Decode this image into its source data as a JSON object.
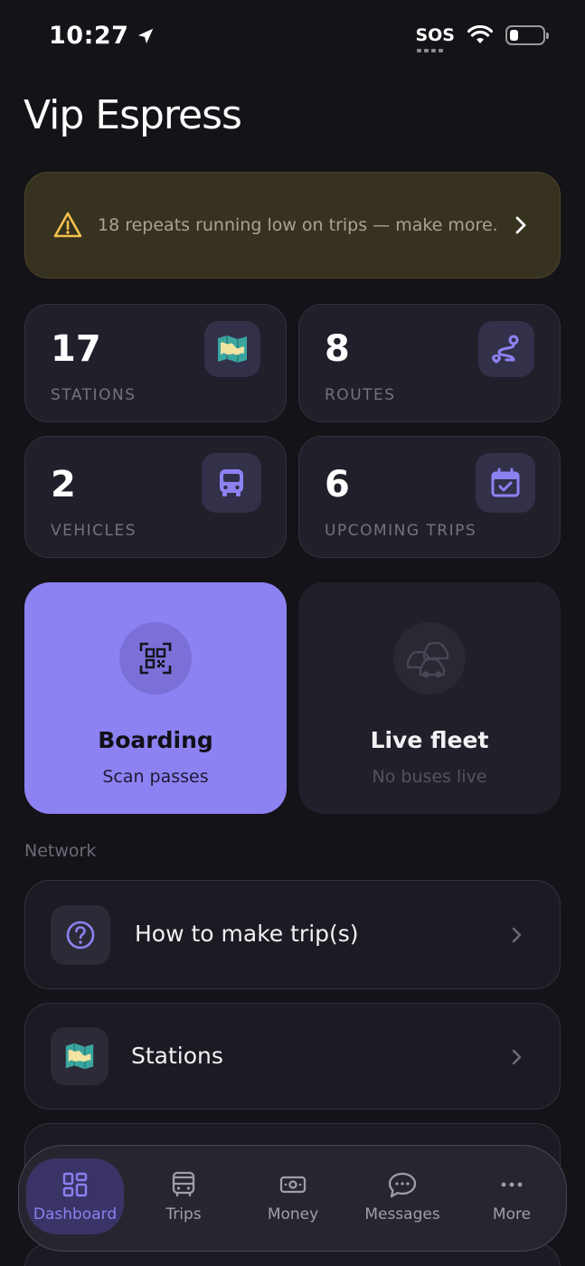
{
  "status_bar": {
    "time": "10:27",
    "sos": "SOS"
  },
  "app": {
    "title": "Vip Espress"
  },
  "alert": {
    "text": "18 repeats running low on trips — make more.",
    "color": "#f2c14e"
  },
  "stats": [
    {
      "value": "17",
      "label": "STATIONS",
      "icon": "map-icon"
    },
    {
      "value": "8",
      "label": "ROUTES",
      "icon": "route-icon"
    },
    {
      "value": "2",
      "label": "VEHICLES",
      "icon": "bus-icon"
    },
    {
      "value": "6",
      "label": "UPCOMING TRIPS",
      "icon": "calendar-check-icon"
    }
  ],
  "actions": {
    "boarding": {
      "title": "Boarding",
      "subtitle": "Scan passes",
      "icon": "qr-scan-icon",
      "color": "#8c82f2"
    },
    "live_fleet": {
      "title": "Live fleet",
      "subtitle": "No buses live",
      "icon": "cars-icon"
    }
  },
  "network": {
    "label": "Network",
    "items": [
      {
        "label": "How to make trip(s)",
        "icon": "help-circle-icon"
      },
      {
        "label": "Stations",
        "icon": "map-icon"
      }
    ]
  },
  "tabs": [
    {
      "label": "Dashboard",
      "icon": "dashboard-icon",
      "active": true
    },
    {
      "label": "Trips",
      "icon": "bus-icon",
      "active": false
    },
    {
      "label": "Money",
      "icon": "money-icon",
      "active": false
    },
    {
      "label": "Messages",
      "icon": "chat-icon",
      "active": false
    },
    {
      "label": "More",
      "icon": "more-icon",
      "active": false
    }
  ],
  "accent": "#8c82f2"
}
